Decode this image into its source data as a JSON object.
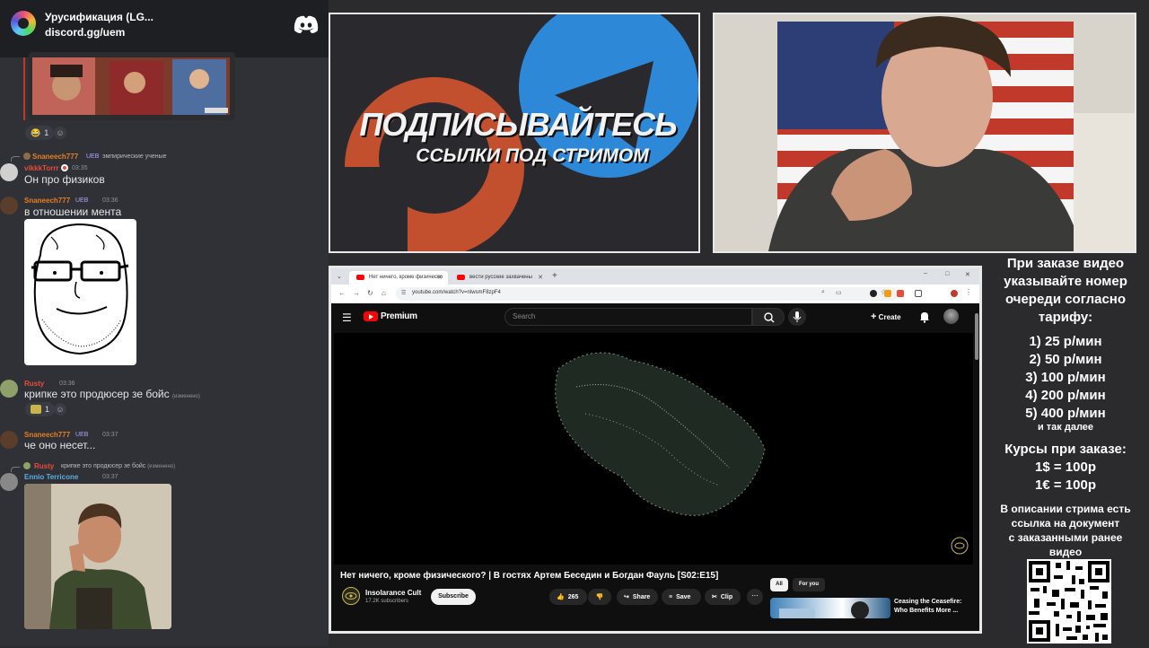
{
  "discord": {
    "server_name": "Урусификация (LG...",
    "invite": "discord.gg/uem",
    "reactions": {
      "first_count": "1",
      "second_count": "1"
    },
    "messages": [
      {
        "reply_user": "Snaneech777",
        "reply_badge": "UEB",
        "reply_text": "эмпирические ученые",
        "user": "vikkkTorrr",
        "time": "03:35",
        "text": "Он про физиков"
      },
      {
        "user": "Snaneech777",
        "badge": "UEB",
        "time": "03:36",
        "text": "в отношении мента"
      },
      {
        "user": "Rusty",
        "time": "03:36",
        "text": "крипке это продюсер зе бойс",
        "edited": "(изменено)"
      },
      {
        "user": "Snaneech777",
        "badge": "UEB",
        "time": "03:37",
        "text": "че оно несет..."
      },
      {
        "reply_user": "Rusty",
        "reply_text": "крипке это продюсер зе бойс",
        "reply_edited": "(изменено)",
        "user": "Ennio Terricone",
        "time": "03:37"
      }
    ]
  },
  "promo": {
    "title": "ПОДПИСЫВАЙТЕСЬ",
    "subtitle": "ССЫЛКИ ПОД СТРИМОМ"
  },
  "browser": {
    "tabs": [
      {
        "label": "Нет ничего, кроме физическо"
      },
      {
        "label": "вести русские захвачены"
      }
    ],
    "url": "youtube.com/watch?v=nlwsmF8zpF4",
    "youtube": {
      "brand": "Premium",
      "search_placeholder": "Search",
      "create_label": "Create",
      "video_title": "Нет ничего, кроме физического? | В гостях Артем Беседин и Богдан Фауль [S02:E15]",
      "channel_name": "Insolarance Cult",
      "channel_subs": "17.2K subscribers",
      "subscribe_label": "Subscribe",
      "like_count": "265",
      "share_label": "Share",
      "save_label": "Save",
      "clip_label": "Clip",
      "chips": [
        "All",
        "For you"
      ],
      "rec_title": "Ceasing the Ceasefire: Who Benefits More ..."
    }
  },
  "info": {
    "intro": [
      "При заказе видео",
      "указывайте номер",
      "очереди согласно",
      "тарифу:"
    ],
    "tariffs": [
      "1) 25 р/мин",
      "2) 50 р/мин",
      "3) 100 р/мин",
      "4) 200 р/мин",
      "5) 400 р/мин"
    ],
    "etc": "и так далее",
    "rates_title": "Курсы при заказе:",
    "rates": [
      "1$ = 100р",
      "1€ = 100р"
    ],
    "desc": [
      "В описании стрима есть",
      "ссылка на документ",
      "с заказанными ранее",
      "видео"
    ]
  },
  "colors": {
    "discord_bg": "#2f3136",
    "youtube_red": "#ff0000",
    "promo_orange": "#c2502f",
    "telegram_blue": "#2e88d8"
  }
}
